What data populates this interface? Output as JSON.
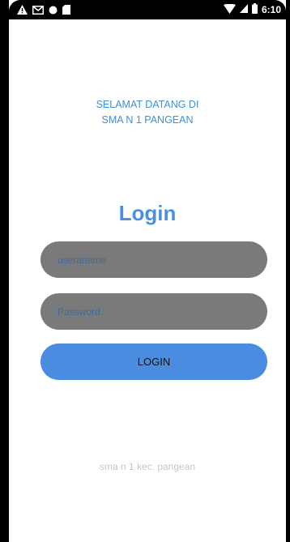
{
  "status_bar": {
    "time": "6:10",
    "left_icons": [
      "alert-icon",
      "gmail-icon",
      "dot-icon",
      "sd-card-icon"
    ],
    "right_icons": [
      "wifi-icon",
      "signal-icon",
      "battery-icon"
    ]
  },
  "welcome": {
    "line1": "SELAMAT DATANG DI",
    "line2": "SMA N 1 PANGEAN"
  },
  "login_title": "Login",
  "form": {
    "username_placeholder": "useraname",
    "password_placeholder": "Password.",
    "login_button": "LOGIN"
  },
  "footer": "sma n 1 kec. pangean",
  "colors": {
    "accent": "#4a90e2",
    "field_bg": "#7a7a7a",
    "button_bg": "#4a8de0",
    "footer_text": "#c6c6c6"
  }
}
